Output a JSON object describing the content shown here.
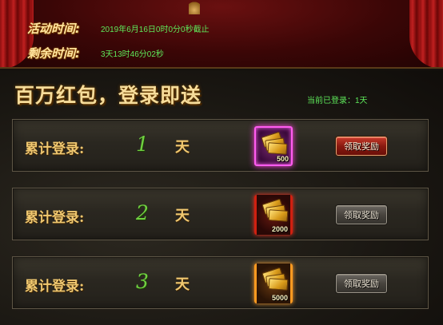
{
  "event": {
    "time_label": "活动时间:",
    "time_value": "2019年6月16日0时0分0秒截止",
    "remaining_label": "剩余时间:",
    "remaining_value": "3天13时46分02秒"
  },
  "main": {
    "title": "百万红包，登录即送",
    "login_status": "当前已登录：1天"
  },
  "rows": [
    {
      "label": "累计登录:",
      "days": "1",
      "unit": "天",
      "reward_amount": "500",
      "button": "领取奖励",
      "button_state": "active"
    },
    {
      "label": "累计登录:",
      "days": "2",
      "unit": "天",
      "reward_amount": "2000",
      "button": "领取奖励",
      "button_state": "inactive"
    },
    {
      "label": "累计登录:",
      "days": "3",
      "unit": "天",
      "reward_amount": "5000",
      "button": "领取奖励",
      "button_state": "inactive"
    }
  ],
  "colors": {
    "accent_green": "#5ee85a",
    "gold_text": "#f0c870",
    "active_button": "#8a1a10",
    "inactive_button": "#48443e"
  },
  "icons": [
    "curtain-icon",
    "red-envelope-notes-icon"
  ]
}
